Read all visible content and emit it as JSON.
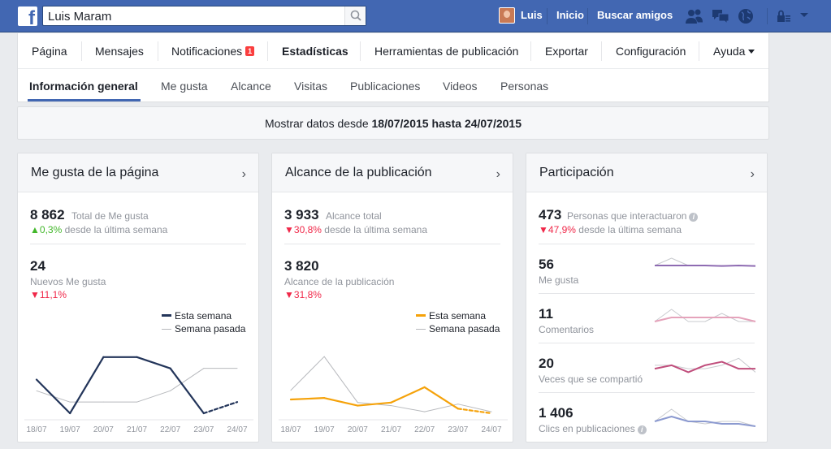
{
  "header": {
    "search_value": "Luis Maram",
    "user_name": "Luis",
    "home_label": "Inicio",
    "find_friends_label": "Buscar amigos"
  },
  "nav": {
    "tabs": [
      {
        "label": "Página"
      },
      {
        "label": "Mensajes"
      },
      {
        "label": "Notificaciones",
        "badge": "1"
      },
      {
        "label": "Estadísticas"
      },
      {
        "label": "Herramientas de publicación"
      },
      {
        "label": "Exportar"
      },
      {
        "label": "Configuración"
      },
      {
        "label": "Ayuda"
      }
    ],
    "subtabs": [
      {
        "label": "Información general"
      },
      {
        "label": "Me gusta"
      },
      {
        "label": "Alcance"
      },
      {
        "label": "Visitas"
      },
      {
        "label": "Publicaciones"
      },
      {
        "label": "Videos"
      },
      {
        "label": "Personas"
      }
    ]
  },
  "daterange": {
    "prefix": "Mostrar datos desde",
    "from": "18/07/2015",
    "middle": "hasta",
    "to": "24/07/2015"
  },
  "cards": {
    "likes": {
      "title": "Me gusta de la página",
      "total_value": "8 862",
      "total_label": "Total de Me gusta",
      "total_change": "0,3%",
      "change_suffix": "desde la última semana",
      "new_value": "24",
      "new_label": "Nuevos Me gusta",
      "new_change": "11,1%",
      "legend_this": "Esta semana",
      "legend_last": "Semana pasada"
    },
    "reach": {
      "title": "Alcance de la publicación",
      "total_value": "3 933",
      "total_label": "Alcance total",
      "total_change": "30,8%",
      "change_suffix": "desde la última semana",
      "post_value": "3 820",
      "post_label": "Alcance de la publicación",
      "post_change": "31,8%",
      "legend_this": "Esta semana",
      "legend_last": "Semana pasada"
    },
    "engagement": {
      "title": "Participación",
      "total_value": "473",
      "total_label": "Personas que interactuaron",
      "total_change": "47,9%",
      "change_suffix": "desde la última semana",
      "rows": [
        {
          "value": "56",
          "label": "Me gusta"
        },
        {
          "value": "11",
          "label": "Comentarios"
        },
        {
          "value": "20",
          "label": "Veces que se compartió"
        },
        {
          "value": "1 406",
          "label": "Clics en publicaciones"
        }
      ]
    }
  },
  "chart_data": [
    {
      "type": "line",
      "x": [
        "18/07",
        "19/07",
        "20/07",
        "21/07",
        "22/07",
        "23/07",
        "24/07"
      ],
      "series": [
        {
          "name": "Esta semana",
          "color": "#23355a",
          "values": [
            3,
            0,
            5,
            5,
            4,
            0,
            1
          ],
          "last_segment_dashed": true
        },
        {
          "name": "Semana pasada",
          "color": "#b7b9bd",
          "values": [
            2,
            1,
            1,
            1,
            2,
            4,
            4
          ]
        }
      ],
      "ylim": [
        0,
        6
      ],
      "legend": "top-right"
    },
    {
      "type": "line",
      "x": [
        "18/07",
        "19/07",
        "20/07",
        "21/07",
        "22/07",
        "23/07",
        "24/07"
      ],
      "series": [
        {
          "name": "Esta semana",
          "color": "#f5a20a",
          "values": [
            450,
            500,
            250,
            350,
            850,
            150,
            0
          ],
          "last_segment_dashed": true
        },
        {
          "name": "Semana pasada",
          "color": "#b7b9bd",
          "values": [
            750,
            1850,
            350,
            250,
            50,
            300,
            50
          ]
        }
      ],
      "ylim": [
        0,
        2200
      ],
      "legend": "top-right"
    },
    {
      "type": "line",
      "label": "Me gusta",
      "series": [
        {
          "color": "#8e6bb2",
          "values": [
            6,
            6,
            6,
            6,
            5.8,
            6,
            5.8
          ]
        },
        {
          "color": "#c9cbcf",
          "values": [
            6,
            9,
            6,
            6,
            6,
            6,
            6
          ]
        }
      ],
      "ylim": [
        0,
        10
      ]
    },
    {
      "type": "line",
      "label": "Comentarios",
      "series": [
        {
          "color": "#e5a3bb",
          "values": [
            2,
            3,
            3,
            3,
            3,
            3,
            2
          ]
        },
        {
          "color": "#c9cbcf",
          "values": [
            2,
            5,
            2,
            2,
            4,
            2,
            2
          ]
        }
      ],
      "ylim": [
        0,
        6
      ]
    },
    {
      "type": "line",
      "label": "Veces que se compartió",
      "series": [
        {
          "color": "#c04e7c",
          "values": [
            3,
            4,
            2,
            4,
            5,
            3,
            3
          ]
        },
        {
          "color": "#c9cbcf",
          "values": [
            4,
            4,
            3,
            3,
            4,
            6,
            2
          ]
        }
      ],
      "ylim": [
        0,
        7
      ]
    },
    {
      "type": "line",
      "label": "Clics en publicaciones",
      "series": [
        {
          "color": "#8c9ad0",
          "values": [
            3,
            5,
            3,
            3,
            2,
            2,
            1
          ]
        },
        {
          "color": "#c9cbcf",
          "values": [
            3,
            8,
            3,
            2,
            3,
            3,
            1
          ]
        }
      ],
      "ylim": [
        0,
        10
      ]
    }
  ]
}
